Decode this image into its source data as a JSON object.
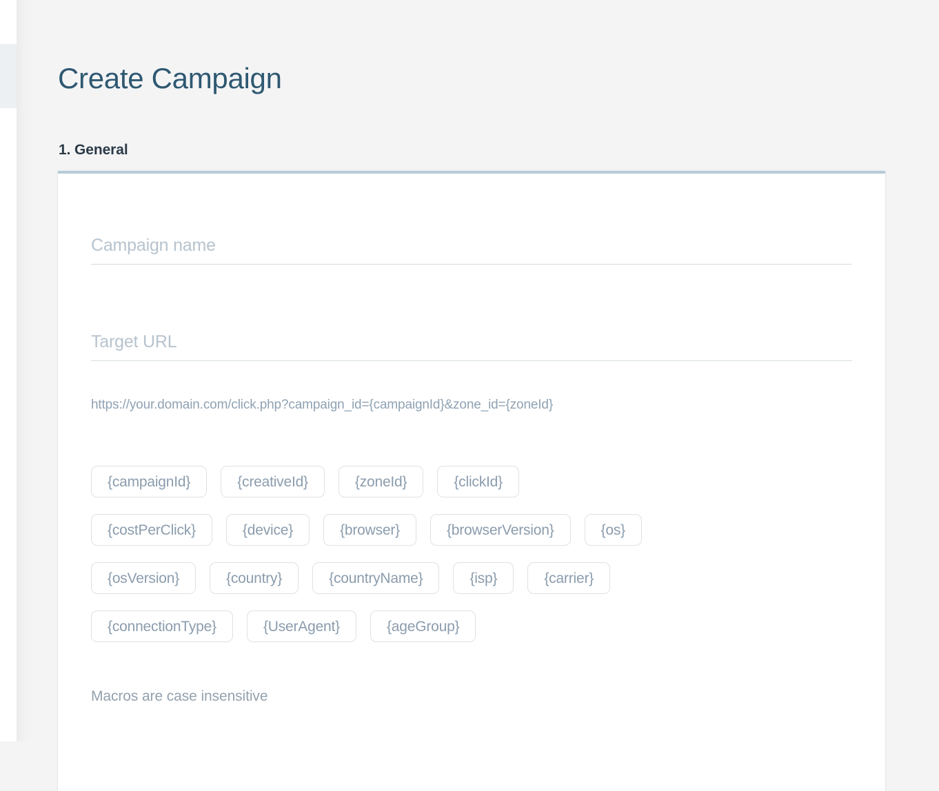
{
  "page": {
    "title": "Create Campaign",
    "background_color": "#f4f4f5"
  },
  "sidebar": {
    "active_item_highlight_color": "#ecf0f3",
    "strip_color": "#ffffff"
  },
  "section": {
    "heading": "1. General",
    "accent_top_border_color": "#b6cbd9",
    "card_background": "#ffffff"
  },
  "form": {
    "campaign_name": {
      "label": "Campaign name",
      "placeholder": "Campaign name",
      "value": ""
    },
    "target_url": {
      "label": "Target URL",
      "placeholder": "Target URL",
      "value": ""
    },
    "url_example": "https://your.domain.com/click.php?campaign_id={campaignId}&zone_id={zoneId}"
  },
  "macros": {
    "note": "Macros are case insensitive",
    "rows": [
      [
        "{campaignId}",
        "{creativeId}",
        "{zoneId}",
        "{clickId}"
      ],
      [
        "{costPerClick}",
        "{device}",
        "{browser}",
        "{browserVersion}",
        "{os}"
      ],
      [
        "{osVersion}",
        "{country}",
        "{countryName}",
        "{isp}",
        "{carrier}"
      ],
      [
        "{connectionType}",
        "{UserAgent}",
        "{ageGroup}"
      ]
    ]
  },
  "colors": {
    "title_text": "#2e5871",
    "heading_text": "#2b3a47",
    "placeholder_text": "#b7c3ce",
    "hint_text": "#8fa2b3",
    "chip_text": "#8b9cad",
    "chip_border": "#dde1e5",
    "input_underline": "#d7dce0"
  }
}
